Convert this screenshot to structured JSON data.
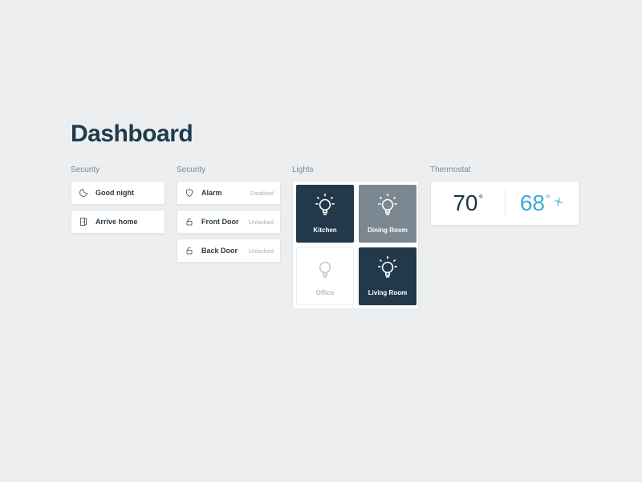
{
  "page_title": "Dashboard",
  "colors": {
    "tile_on": "#22394b",
    "tile_dim": "#7b8892",
    "accent_cool": "#3fa8d8",
    "text_dark": "#1f3a4d"
  },
  "scenes": {
    "label": "Security",
    "items": [
      {
        "icon": "moon-icon",
        "label": "Good night"
      },
      {
        "icon": "door-open-icon",
        "label": "Arrive home"
      }
    ]
  },
  "security": {
    "label": "Security",
    "items": [
      {
        "icon": "shield-icon",
        "label": "Alarm",
        "status": "Disabled"
      },
      {
        "icon": "lock-open-icon",
        "label": "Front Door",
        "status": "Unlocked"
      },
      {
        "icon": "lock-open-icon",
        "label": "Back Door",
        "status": "Unlocked"
      }
    ]
  },
  "lights": {
    "label": "Lights",
    "rooms": [
      {
        "name": "Kitchen",
        "state": "on-dark"
      },
      {
        "name": "Dining Room",
        "state": "on-dim"
      },
      {
        "name": "Office",
        "state": "off"
      },
      {
        "name": "Living Room",
        "state": "on-dark"
      }
    ]
  },
  "thermostat": {
    "label": "Thermostat",
    "current": "70",
    "target": "68",
    "degree": "°",
    "mode_icon": "fan-icon"
  }
}
